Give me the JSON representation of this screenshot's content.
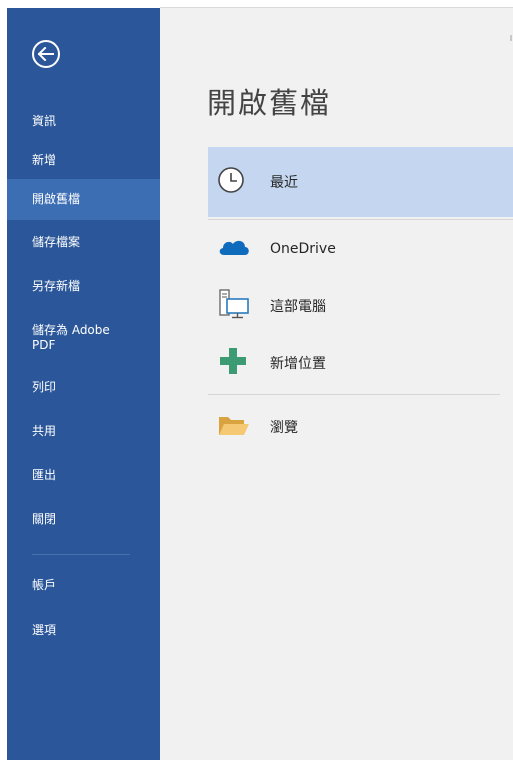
{
  "sidebar": {
    "back_icon": "back-arrow-icon",
    "items": [
      {
        "label": "資訊"
      },
      {
        "label": "新增"
      },
      {
        "label": "開啟舊檔",
        "selected": true
      },
      {
        "label": "儲存檔案"
      },
      {
        "label": "另存新檔"
      },
      {
        "label": "儲存為 Adobe PDF"
      },
      {
        "label": "列印"
      },
      {
        "label": "共用"
      },
      {
        "label": "匯出"
      },
      {
        "label": "關閉"
      },
      {
        "label": "帳戶"
      },
      {
        "label": "選項"
      }
    ]
  },
  "main": {
    "title": "開啟舊檔",
    "locations": [
      {
        "label": "最近",
        "icon": "clock-icon"
      },
      {
        "label": "OneDrive",
        "icon": "onedrive-cloud-icon"
      },
      {
        "label": "這部電腦",
        "icon": "this-pc-icon"
      },
      {
        "label": "新增位置",
        "icon": "add-place-icon"
      },
      {
        "label": "瀏覽",
        "icon": "folder-icon"
      }
    ]
  },
  "colors": {
    "sidebar": "#2b579a",
    "sidebar_selected": "#3c6eb4",
    "main_bg": "#f1f1f1",
    "recent_highlight": "#c5d7f0"
  }
}
